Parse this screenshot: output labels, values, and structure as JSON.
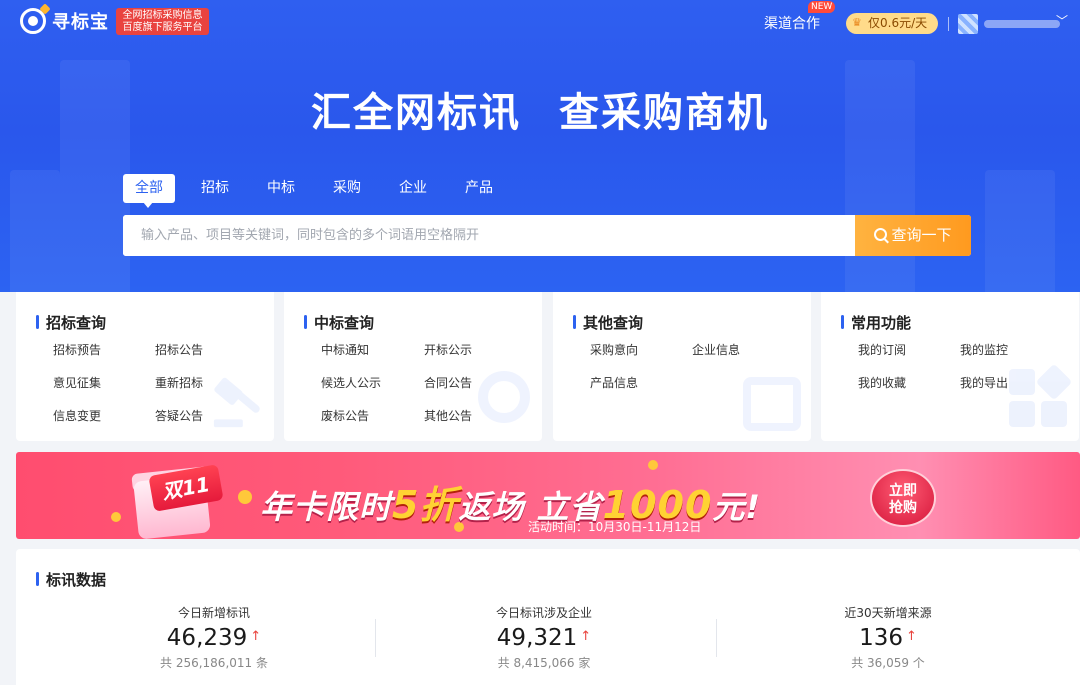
{
  "header": {
    "logo_text": "寻标宝",
    "slogan_line1": "全网招标采购信息",
    "slogan_line2": "百度旗下服务平台",
    "channel_label": "渠道合作",
    "new_badge": "NEW",
    "price_label": "仅0.6元/天"
  },
  "hero": {
    "headline": "汇全网标讯 查采购商机",
    "tabs": [
      "全部",
      "招标",
      "中标",
      "采购",
      "企业",
      "产品"
    ],
    "active_tab": 0,
    "search_placeholder": "输入产品、项目等关键词，同时包含的多个词语用空格隔开",
    "search_value": "",
    "search_button": "查询一下"
  },
  "cards": [
    {
      "title": "招标查询",
      "icon": "gavel-icon",
      "links": [
        "招标预告",
        "招标公告",
        "意见征集",
        "重新招标",
        "信息变更",
        "答疑公告"
      ]
    },
    {
      "title": "中标查询",
      "icon": "target-icon",
      "links": [
        "中标通知",
        "开标公示",
        "候选人公示",
        "合同公告",
        "废标公告",
        "其他公告"
      ]
    },
    {
      "title": "其他查询",
      "icon": "calendar-search-icon",
      "links": [
        "采购意向",
        "企业信息",
        "产品信息"
      ]
    },
    {
      "title": "常用功能",
      "icon": "grid-icon",
      "links": [
        "我的订阅",
        "我的监控",
        "我的收藏",
        "我的导出"
      ]
    }
  ],
  "banner": {
    "badge": "双11",
    "text_a": "年卡限时",
    "text_b": "5折",
    "text_c": "返场 立省",
    "text_d": "1000",
    "text_e": "元!",
    "subtitle": "活动时间：10月30日-11月12日",
    "button_line1": "立即",
    "button_line2": "抢购"
  },
  "stats": {
    "title": "标讯数据",
    "items": [
      {
        "label": "今日新增标讯",
        "value": "46,239",
        "total": "共 256,186,011 条"
      },
      {
        "label": "今日标讯涉及企业",
        "value": "49,321",
        "total": "共 8,415,066 家"
      },
      {
        "label": "近30天新增来源",
        "value": "136",
        "total": "共 36,059 个"
      }
    ]
  },
  "colors": {
    "primary": "#2d62f0",
    "accent": "#ff9a1f",
    "up": "#e8433d"
  }
}
